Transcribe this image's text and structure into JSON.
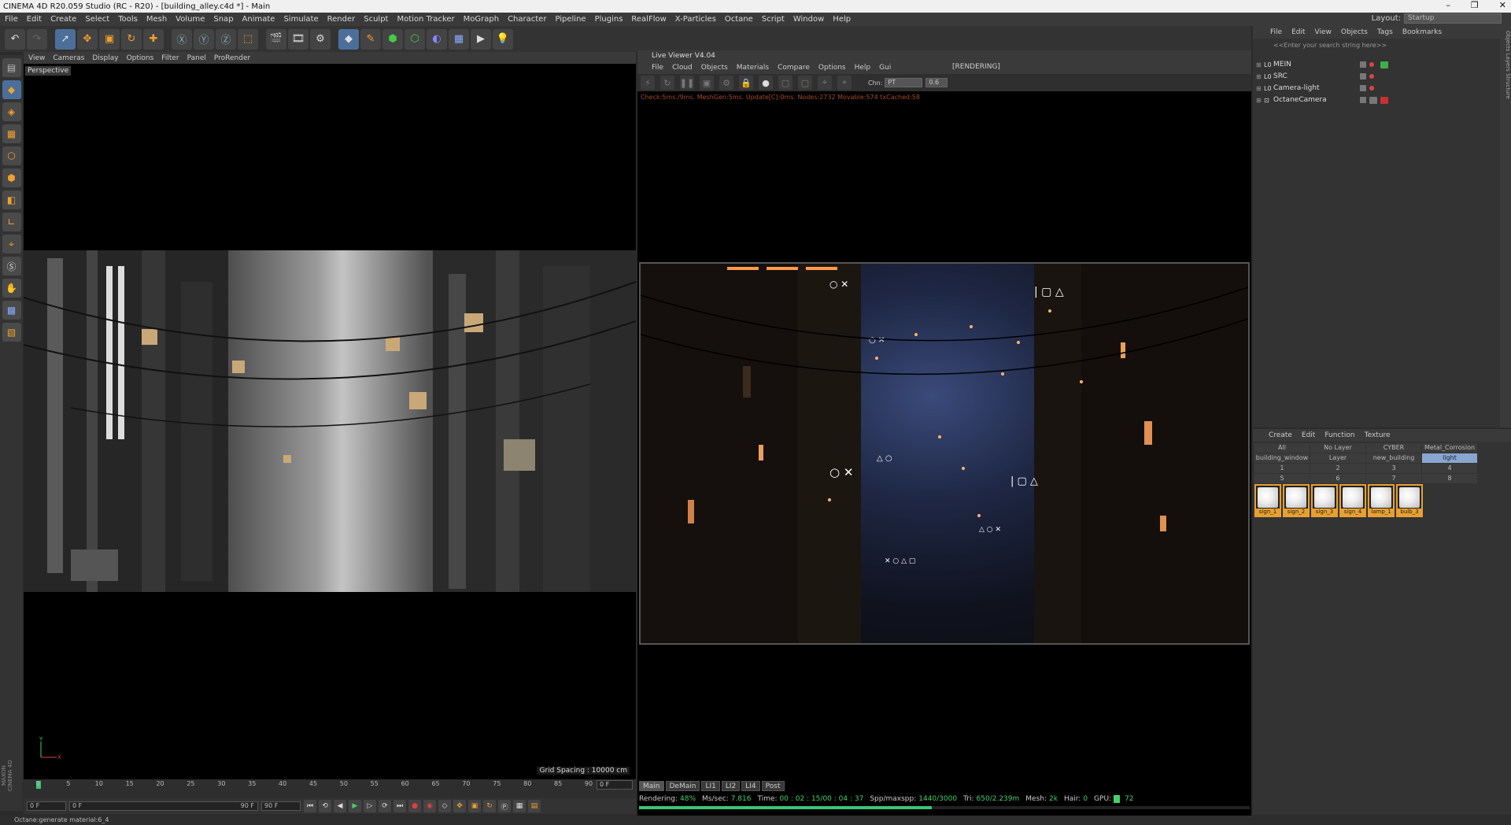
{
  "window": {
    "title": "CINEMA 4D R20.059 Studio (RC - R20) - [building_alley.c4d *] - Main",
    "controls": [
      "–",
      "❐",
      "✕"
    ]
  },
  "menubar": {
    "items": [
      "File",
      "Edit",
      "Create",
      "Select",
      "Tools",
      "Mesh",
      "Volume",
      "Snap",
      "Animate",
      "Simulate",
      "Render",
      "Sculpt",
      "Motion Tracker",
      "MoGraph",
      "Character",
      "Pipeline",
      "Plugins",
      "RealFlow",
      "X-Particles",
      "Octane",
      "Script",
      "Window",
      "Help"
    ],
    "layout_label": "Layout:",
    "layout_value": "Startup"
  },
  "viewport": {
    "menu": [
      "View",
      "Cameras",
      "Display",
      "Options",
      "Filter",
      "Panel",
      "ProRender"
    ],
    "label": "Perspective",
    "grid_spacing": "Grid Spacing : 10000 cm",
    "axis_x": "X",
    "axis_y": "Y"
  },
  "timeline": {
    "ticks": [
      "0",
      "5",
      "10",
      "15",
      "20",
      "25",
      "30",
      "35",
      "40",
      "45",
      "50",
      "55",
      "60",
      "65",
      "70",
      "75",
      "80",
      "85",
      "90"
    ],
    "max_frame": 90,
    "current_frame": "0 F",
    "start_field": "0 F",
    "preview_start": "0 F",
    "preview_end": "90 F",
    "end_field": "90 F"
  },
  "status_bar": {
    "text": "Octane:generate material:6_4"
  },
  "live_viewer": {
    "title": "Live Viewer V4.04",
    "menu": [
      "File",
      "Cloud",
      "Objects",
      "Materials",
      "Compare",
      "Options",
      "Help",
      "Gui"
    ],
    "render_state": "[RENDERING]",
    "chn_label": "Chn:",
    "chn_value": "PT",
    "chn_number": "0.6",
    "log": "Check:5ms./9ms. MeshGen:5ms. Update[C]:0ms. Nodes:2732 Movable:574 txCached:58",
    "tabs": [
      "Main",
      "DeMain",
      "LI1",
      "LI2",
      "LI4",
      "Post"
    ],
    "stats": {
      "rendering_label": "Rendering:",
      "rendering_value": "48%",
      "ms_label": "Ms/sec:",
      "ms_value": "7.816",
      "time_label": "Time:",
      "time_value": "00 : 02 : 15/00 : 04 : 37",
      "spp_label": "Spp/maxspp:",
      "spp_value": "1440/3000",
      "tri_label": "Tri:",
      "tri_value": "650/2.239m",
      "mesh_label": "Mesh:",
      "mesh_value": "2k",
      "hair_label": "Hair:",
      "hair_value": "0",
      "gpu_label": "GPU:",
      "gpu_value": "72"
    },
    "progress": 0.48
  },
  "object_manager": {
    "menu": [
      "File",
      "Edit",
      "View",
      "Objects",
      "Tags",
      "Bookmarks"
    ],
    "search_placeholder": "<<Enter your search string here>>",
    "objects": [
      {
        "name": "MEIN",
        "tag_color": "#3cb04a"
      },
      {
        "name": "SRC",
        "tag_color": ""
      },
      {
        "name": "Camera-light",
        "tag_color": ""
      },
      {
        "name": "OctaneCamera",
        "tag_color": "#c83030"
      }
    ],
    "side_tabs": "Objects  Layers  Structure"
  },
  "material_manager": {
    "menu": [
      "Create",
      "Edit",
      "Function",
      "Texture"
    ],
    "layers": [
      [
        "All",
        "No Layer",
        "CYBER",
        "Metal_Corrosion"
      ],
      [
        "building_window",
        "Layer",
        "new_building",
        "light"
      ],
      [
        "1",
        "2",
        "3",
        "4"
      ],
      [
        "5",
        "6",
        "7",
        "8"
      ]
    ],
    "selected_layer": "light",
    "materials": [
      "sign_1",
      "sign_2",
      "sign_3",
      "sign_4",
      "lamp_1",
      "bulb_3"
    ]
  },
  "colors": {
    "accent_orange": "#f2a02e",
    "render_green": "#3ec27a"
  }
}
